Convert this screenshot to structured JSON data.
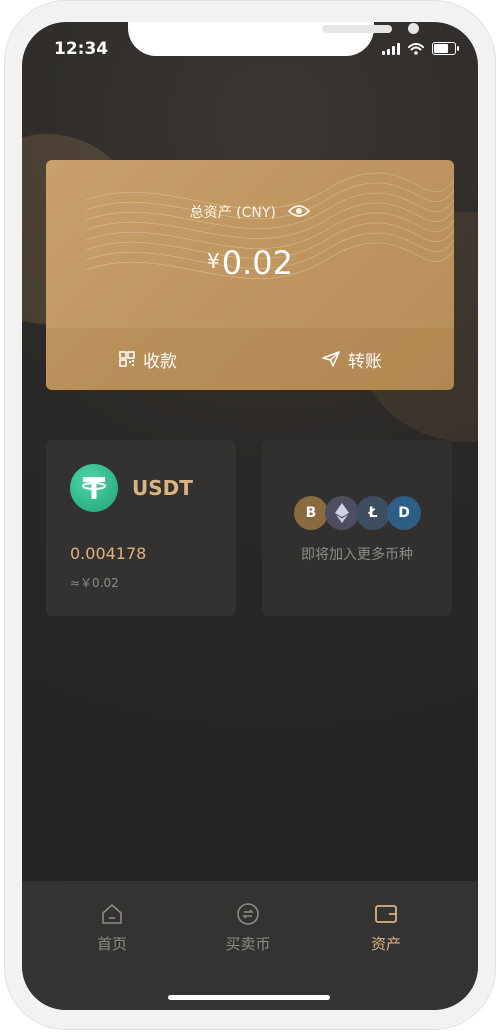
{
  "status_bar": {
    "time": "12:34",
    "battery_level": 0.8
  },
  "asset_card": {
    "label": "总资产 (CNY)",
    "currency_symbol": "¥",
    "amount": "0.02",
    "actions": [
      {
        "label": "收款",
        "icon": "qr-code-icon"
      },
      {
        "label": "转账",
        "icon": "send-icon"
      }
    ]
  },
  "coins": [
    {
      "symbol": "USDT",
      "balance": "0.004178",
      "value_cny": "≈￥0.02",
      "icon": "tether-icon"
    }
  ],
  "more_coins": {
    "text": "即将加入更多币种",
    "icons": [
      "bitcoin-icon",
      "ethereum-icon",
      "litecoin-icon",
      "dash-icon"
    ]
  },
  "tabbar": {
    "items": [
      {
        "label": "首页",
        "icon": "home-icon",
        "active": false
      },
      {
        "label": "买卖币",
        "icon": "exchange-icon",
        "active": false
      },
      {
        "label": "资产",
        "icon": "wallet-icon",
        "active": true
      }
    ]
  },
  "colors": {
    "accent": "#d8b483",
    "card": "#c29a63",
    "background": "#252422"
  }
}
